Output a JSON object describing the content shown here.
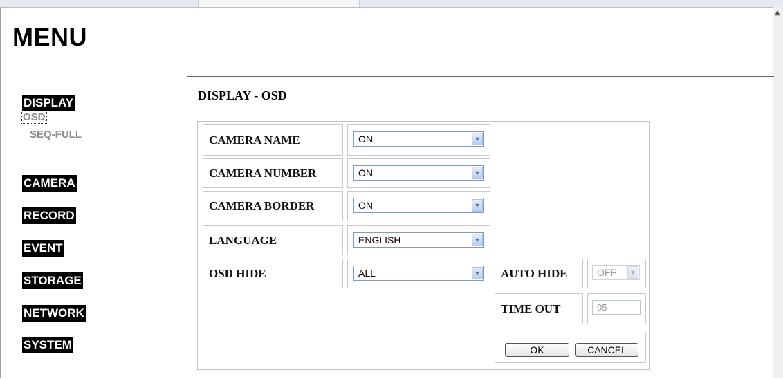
{
  "menu": {
    "title": "MENU"
  },
  "nav": {
    "display": "DISPLAY",
    "display_sub": [
      "OSD",
      "SEQ-FULL"
    ],
    "camera": "CAMERA",
    "record": "RECORD",
    "event": "EVENT",
    "storage": "STORAGE",
    "network": "NETWORK",
    "system": "SYSTEM"
  },
  "panel": {
    "title": "DISPLAY - OSD"
  },
  "form": {
    "camera_name": {
      "label": "CAMERA NAME",
      "value": "ON"
    },
    "camera_number": {
      "label": "CAMERA NUMBER",
      "value": "ON"
    },
    "camera_border": {
      "label": "CAMERA BORDER",
      "value": "ON"
    },
    "language": {
      "label": "LANGUAGE",
      "value": "ENGLISH"
    },
    "osd_hide": {
      "label": "OSD HIDE",
      "value": "ALL"
    },
    "auto_hide": {
      "label": "AUTO HIDE",
      "value": "OFF",
      "disabled": true
    },
    "time_out": {
      "label": "TIME OUT",
      "value": "05",
      "disabled": true
    }
  },
  "buttons": {
    "ok": "OK",
    "cancel": "CANCEL"
  }
}
